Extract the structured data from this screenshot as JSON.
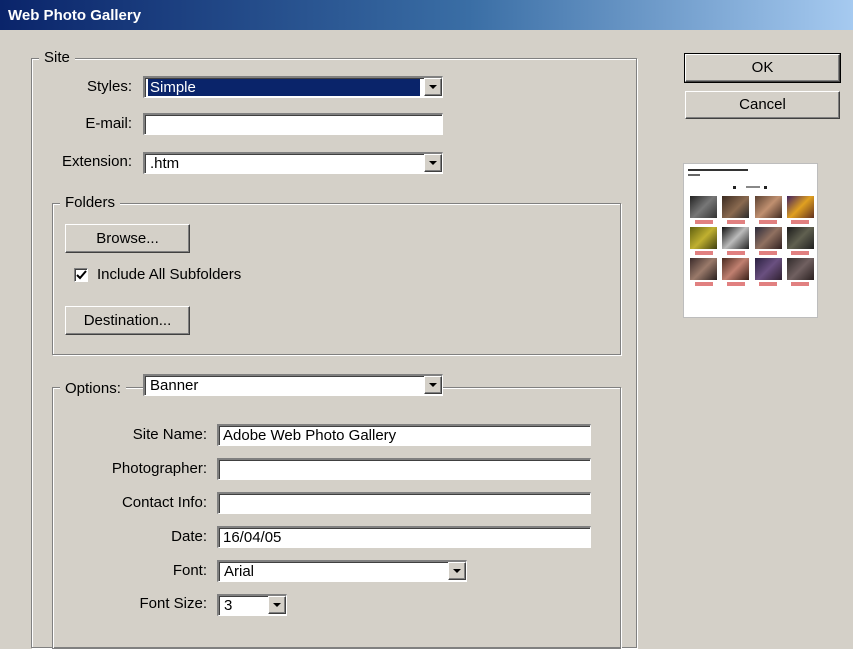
{
  "window": {
    "title": "Web Photo Gallery"
  },
  "buttons": {
    "ok": "OK",
    "cancel": "Cancel"
  },
  "site": {
    "legend": "Site",
    "styles_label": "Styles:",
    "styles_value": "Simple",
    "email_label": "E-mail:",
    "email_value": "",
    "extension_label": "Extension:",
    "extension_value": ".htm"
  },
  "folders": {
    "legend": "Folders",
    "browse_label": "Browse...",
    "include_subfolders_label": "Include All Subfolders",
    "include_subfolders_checked": true,
    "destination_label": "Destination..."
  },
  "options": {
    "label": "Options:",
    "value": "Banner",
    "site_name_label": "Site Name:",
    "site_name_value": "Adobe Web Photo Gallery",
    "photographer_label": "Photographer:",
    "photographer_value": "",
    "contact_label": "Contact Info:",
    "contact_value": "",
    "date_label": "Date:",
    "date_value": "16/04/05",
    "font_label": "Font:",
    "font_value": "Arial",
    "font_size_label": "Font Size:",
    "font_size_value": "3"
  },
  "colors": {
    "titlebar_start": "#0a246a",
    "titlebar_end": "#a6caf0",
    "dialog_bg": "#d4d0c8",
    "selection": "#0a246a"
  }
}
